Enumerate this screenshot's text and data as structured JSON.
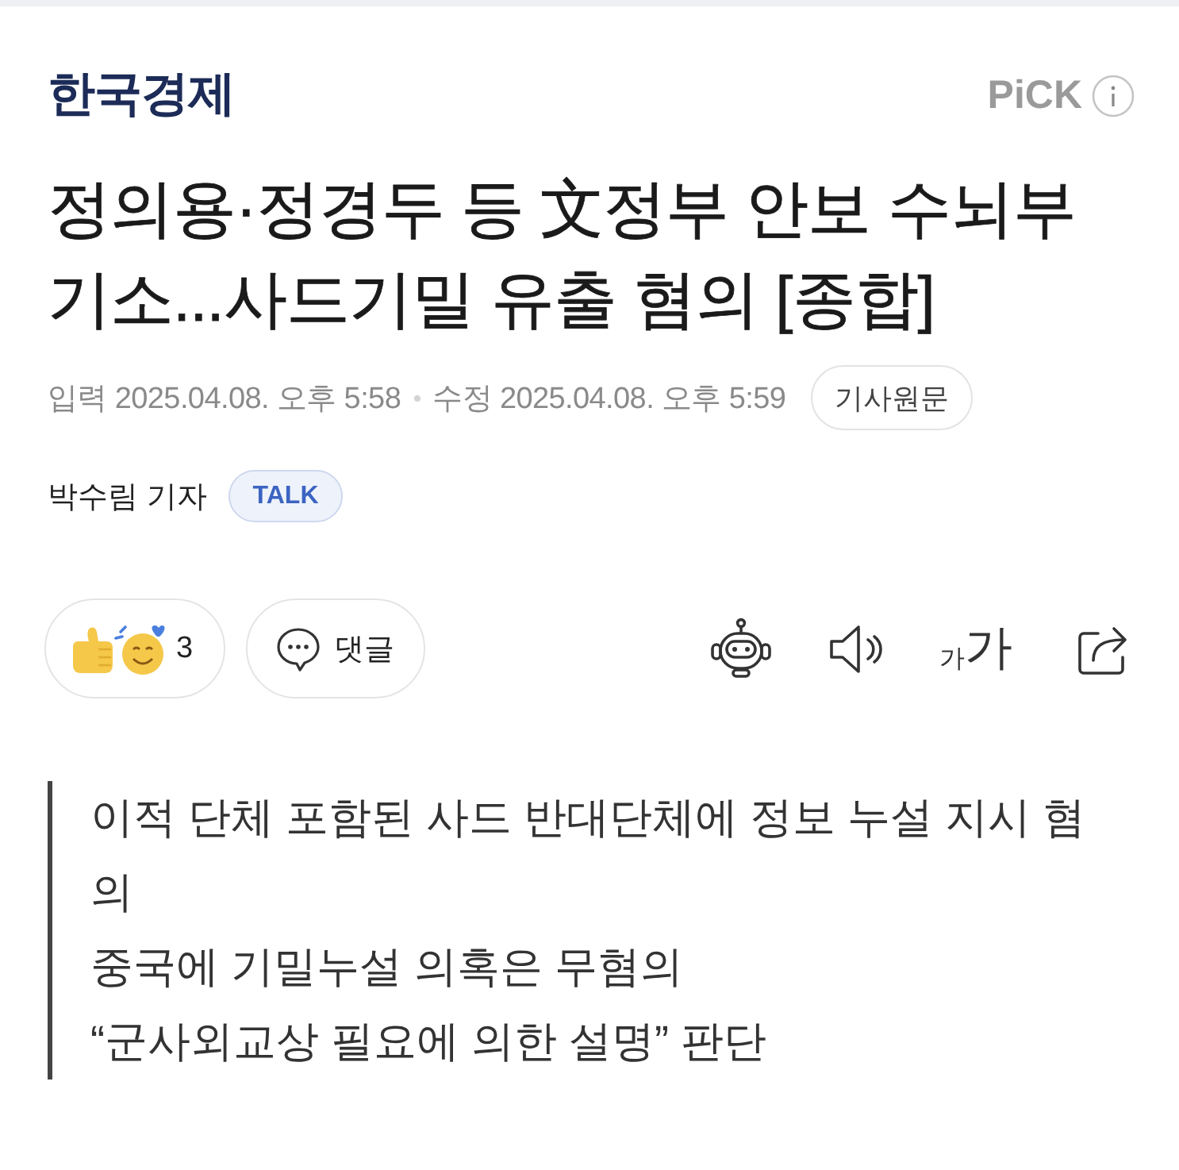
{
  "header": {
    "press": "한국경제",
    "pick_label": "PiCK"
  },
  "article": {
    "title": "정의용·정경두 등 文정부 안보 수뇌부 기소...사드기밀 유출 혐의 [종합]",
    "timestamps": [
      "입력 2025.04.08. 오후 5:58",
      "수정 2025.04.08. 오후 5:59"
    ],
    "original_button": "기사원문",
    "author": "박수림 기자",
    "talk_badge": "TALK"
  },
  "actions": {
    "reaction_count": "3",
    "comment_label": "댓글",
    "text_size_button": {
      "small": "가",
      "large": "가"
    }
  },
  "summary": [
    "이적 단체 포함된 사드 반대단체에 정보 누설 지시 혐의",
    "중국에 기밀누설 의혹은 무혐의",
    "“군사외교상 필요에 의한 설명” 판단"
  ]
}
